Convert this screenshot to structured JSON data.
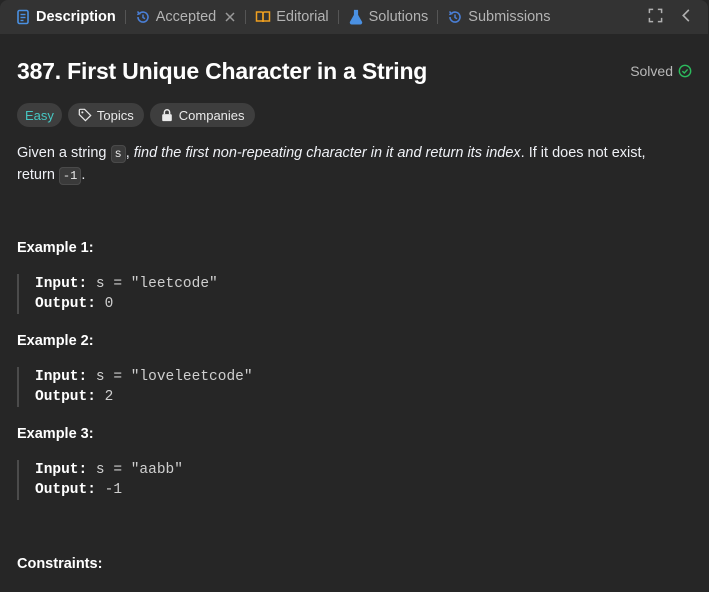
{
  "tabs": [
    {
      "label": "Description",
      "icon": "document-icon",
      "active": true
    },
    {
      "label": "Accepted",
      "icon": "history-icon",
      "closable": true
    },
    {
      "label": "Editorial",
      "icon": "book-icon"
    },
    {
      "label": "Solutions",
      "icon": "flask-icon"
    },
    {
      "label": "Submissions",
      "icon": "history-icon"
    }
  ],
  "problem": {
    "title": "387. First Unique Character in a String",
    "status": "Solved",
    "difficulty": "Easy",
    "topics_label": "Topics",
    "companies_label": "Companies",
    "description": {
      "part1": "Given a string ",
      "code1": "s",
      "part2": ", ",
      "emph": "find the first non-repeating character in it and return its index",
      "part3": ". If it does not exist, return ",
      "code2": "-1",
      "part4": "."
    }
  },
  "examples": [
    {
      "title": "Example 1:",
      "input_label": "Input:",
      "input": "s = \"leetcode\"",
      "output_label": "Output:",
      "output": "0"
    },
    {
      "title": "Example 2:",
      "input_label": "Input:",
      "input": "s = \"loveleetcode\"",
      "output_label": "Output:",
      "output": "2"
    },
    {
      "title": "Example 3:",
      "input_label": "Input:",
      "input": "s = \"aabb\"",
      "output_label": "Output:",
      "output": "-1"
    }
  ],
  "constraints_title": "Constraints:",
  "colors": {
    "background": "#262626",
    "tabbar": "#333333",
    "easy": "#46c6c2",
    "solved_check": "#2cbb5d",
    "description_icon": "#4a90e2",
    "editorial_icon": "#f0a020",
    "solutions_icon": "#4a90e2",
    "history_icon": "#4a7fd6"
  }
}
